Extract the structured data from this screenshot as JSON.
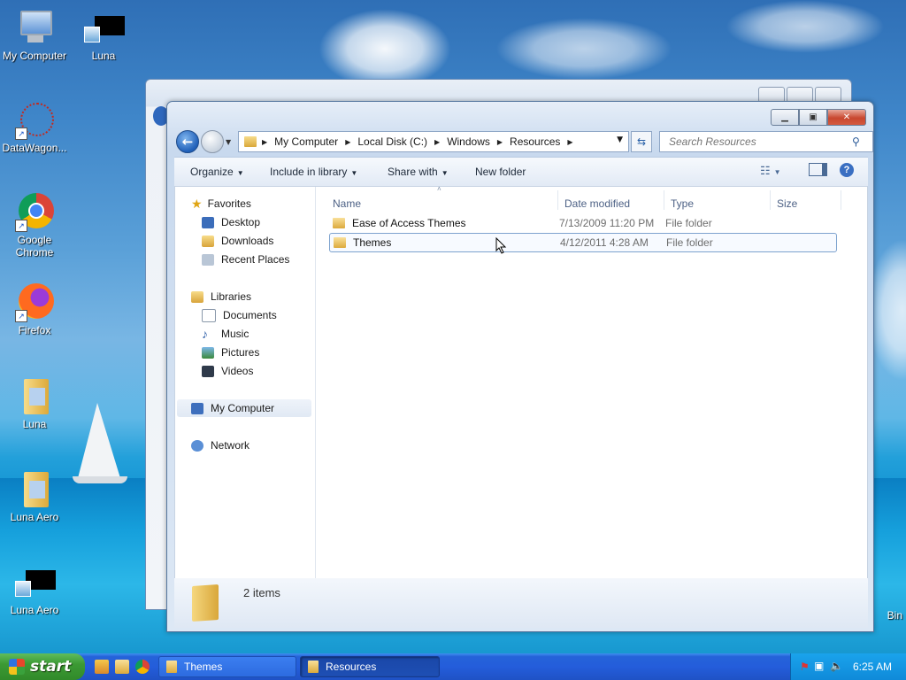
{
  "desktop": {
    "icons": [
      {
        "label": "My Computer",
        "icon": "computer-icon"
      },
      {
        "label": "Luna",
        "icon": "shortcut-icon"
      },
      {
        "label": "DataWagon...",
        "icon": "datawagon-icon"
      },
      {
        "label": "Google Chrome",
        "icon": "chrome-icon"
      },
      {
        "label": "Firefox",
        "icon": "firefox-icon"
      },
      {
        "label": "Luna",
        "icon": "folder-icon"
      },
      {
        "label": "Luna Aero",
        "icon": "folder-icon"
      },
      {
        "label": "Luna Aero",
        "icon": "shortcut-icon"
      },
      {
        "label": "Bin",
        "icon": "recycle-bin-icon"
      }
    ]
  },
  "explorer": {
    "address": {
      "crumbs": [
        "My Computer",
        "Local Disk (C:)",
        "Windows",
        "Resources"
      ]
    },
    "search": {
      "placeholder": "Search Resources"
    },
    "toolbar": {
      "organize": "Organize",
      "include_in_library": "Include in library",
      "share_with": "Share with",
      "new_folder": "New folder"
    },
    "nav": {
      "favorites": "Favorites",
      "desktop": "Desktop",
      "downloads": "Downloads",
      "recent_places": "Recent Places",
      "libraries": "Libraries",
      "documents": "Documents",
      "music": "Music",
      "pictures": "Pictures",
      "videos": "Videos",
      "my_computer": "My Computer",
      "network": "Network"
    },
    "columns": {
      "name": "Name",
      "date_modified": "Date modified",
      "type": "Type",
      "size": "Size"
    },
    "files": [
      {
        "name": "Ease of Access Themes",
        "date": "7/13/2009 11:20 PM",
        "type": "File folder"
      },
      {
        "name": "Themes",
        "date": "4/12/2011 4:28 AM",
        "type": "File folder"
      }
    ],
    "status": {
      "items": "2 items"
    }
  },
  "taskbar": {
    "start_label": "start",
    "tasks": [
      "Themes",
      "Resources"
    ],
    "clock": "6:25 AM"
  }
}
